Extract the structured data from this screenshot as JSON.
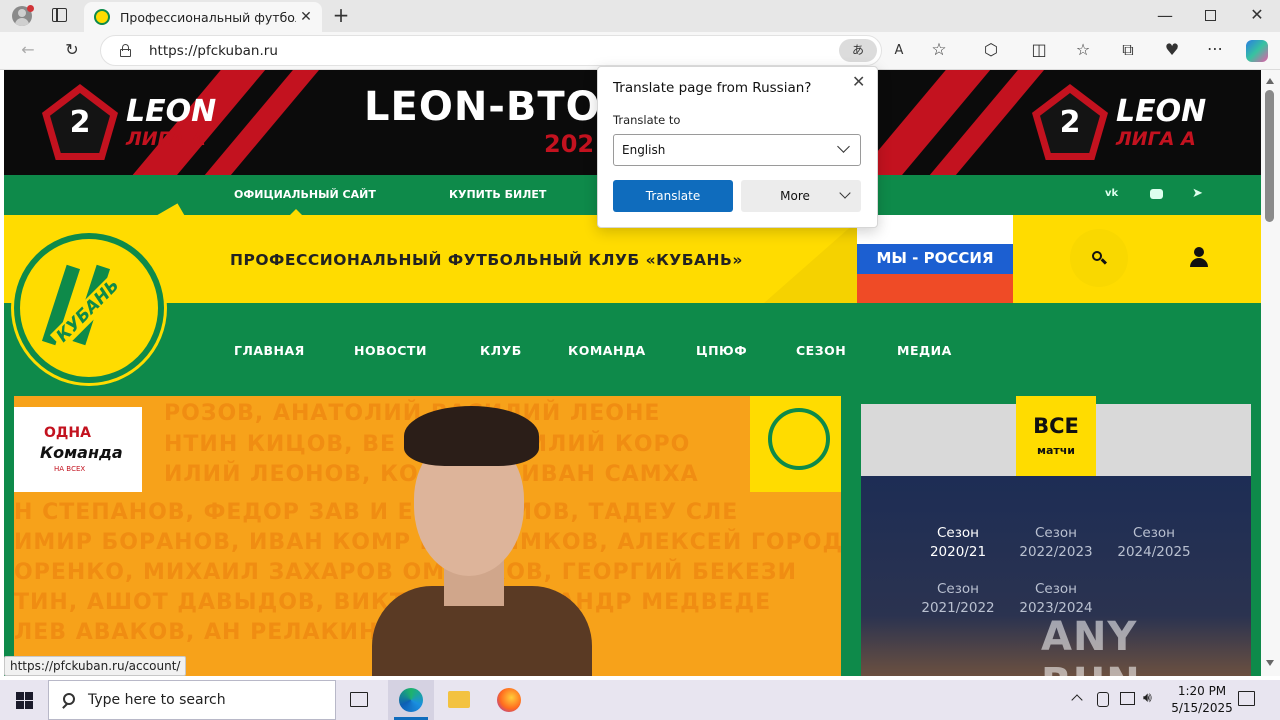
{
  "browser": {
    "tab_title": "Профессиональный футбольный",
    "url": "https://pfckuban.ru",
    "status_url": "https://pfckuban.ru/account/"
  },
  "banner": {
    "headline": "LEON-ВТО",
    "year_partial": "202",
    "league_brand": "LEON",
    "league_sub": "ЛИГА А",
    "league_number": "2",
    "colors": {
      "red": "#c3121f",
      "black": "#0b0b0b"
    }
  },
  "top_nav": {
    "items": [
      "ОФИЦИАЛЬНЫЙ САЙТ",
      "КУПИТЬ БИЛЕТ"
    ],
    "social": [
      "vk-icon",
      "youtube-icon",
      "telegram-icon"
    ]
  },
  "header": {
    "club_title": "ПРОФЕССИОНАЛЬНЫЙ ФУТБОЛЬНЫЙ КЛУБ «КУБАНЬ»",
    "logo_text": "КУБАНЬ",
    "flag_label": "МЫ - РОССИЯ",
    "colors": {
      "yellow": "#ffdc00",
      "green": "#0e8a4a"
    }
  },
  "main_nav": {
    "items": [
      "ГЛАВНАЯ",
      "НОВОСТИ",
      "КЛУБ",
      "КОМАНДА",
      "ЦПЮФ",
      "СЕЗОН",
      "МЕДИА"
    ]
  },
  "hero": {
    "badge_line1": "ОДНА",
    "badge_line2": "Команда",
    "badge_line3": "НА ВСЕХ",
    "bg_lines": [
      "РОЗОВ, АНАТОЛИЙ                   ВАСИЛИЙ ЛЕОНЕ",
      "НТИН КИЦОВ, ВЕ              ЛЕВ, ВАСИЛИЙ КОРО",
      "ИЛИЙ ЛЕОНОВ, КО            ИКОВ, ИВАН САМХА",
      "Н СТЕПАНОВ, ФЕДОР ЗАВ          И ЕВДОКИМОВ, ТАДЕУ СЛЕ",
      "ИМИР БОРАНОВ, ИВАН КОМР          РИО ТИМКОВ, АЛЕКСЕЙ ГОРОД",
      "ОРЕНКО, МИХАИЛ ЗАХАРОВ          ОМНЫХОВ, ГЕОРГИЙ БЕКЕЗИ",
      "ТИН, АШОТ ДАВЫДОВ, ВИКТ          ТИ, АЛЕКСАНДР МЕДВЕДЕ",
      "ЛЕВ АВАКОВ, АН                   РЕЛАКИН, ПЕТР ДИИС"
    ]
  },
  "sidebar": {
    "all_label": "ВСЕ",
    "all_sub": "матчи",
    "seasons": [
      {
        "label": "Сезон",
        "years": "2020/21",
        "active": true
      },
      {
        "label": "Сезон",
        "years": "2022/2023",
        "active": false
      },
      {
        "label": "Сезон",
        "years": "2024/2025",
        "active": false
      },
      {
        "label": "Сезон",
        "years": "2021/2022",
        "active": false
      },
      {
        "label": "Сезон",
        "years": "2023/2024",
        "active": false
      }
    ],
    "watermark": "ANY RUN"
  },
  "translate_popup": {
    "title": "Translate page from Russian?",
    "to_label": "Translate to",
    "selected_language": "English",
    "translate_button": "Translate",
    "more_button": "More",
    "accent": "#0f6cbd"
  },
  "taskbar": {
    "search_placeholder": "Type here to search",
    "time": "1:20 PM",
    "date": "5/15/2025"
  }
}
